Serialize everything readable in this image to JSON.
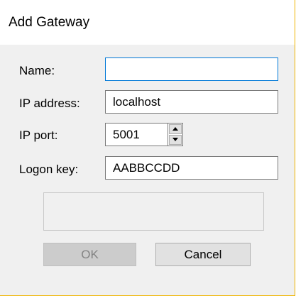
{
  "window": {
    "title": "Add Gateway"
  },
  "form": {
    "name": {
      "label": "Name:",
      "value": ""
    },
    "ip_address": {
      "label": "IP address:",
      "value": "localhost"
    },
    "ip_port": {
      "label": "IP port:",
      "value": "5001"
    },
    "logon_key": {
      "label": "Logon key:",
      "value": "AABBCCDD"
    }
  },
  "status": {
    "text": ""
  },
  "buttons": {
    "ok_label": "OK",
    "ok_enabled": false,
    "cancel_label": "Cancel"
  },
  "icons": {
    "spin_up": "chevron-up-icon",
    "spin_down": "chevron-down-icon"
  },
  "colors": {
    "focus_border": "#0078d7",
    "window_border": "#f0b500",
    "dialog_background": "#f0f0f0",
    "disabled_button_text": "#838383"
  }
}
